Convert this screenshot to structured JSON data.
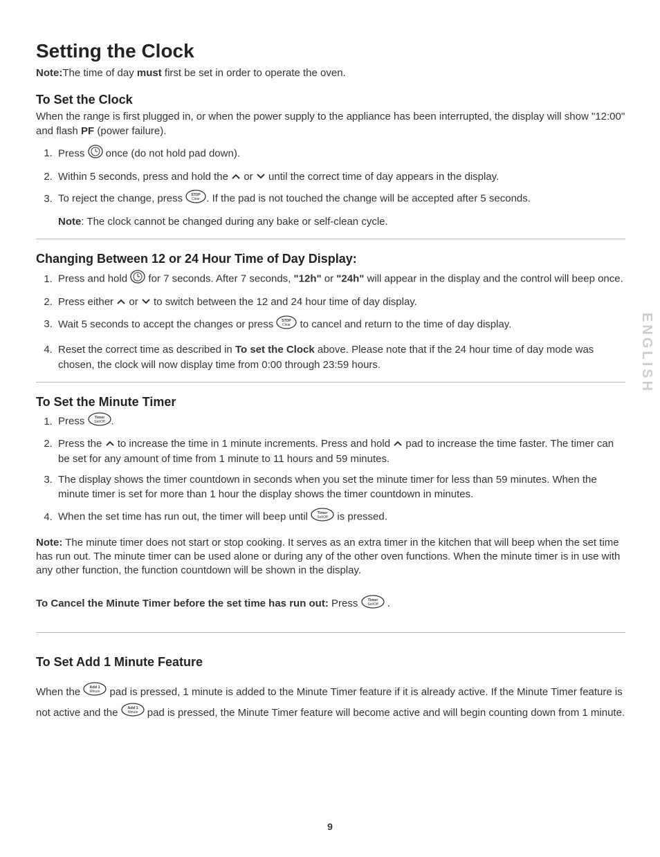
{
  "title": "Setting the Clock",
  "noteLabel": "Note:",
  "intro1": "The time of day ",
  "introMust": "must",
  "intro2": " first be set in order to operate the oven.",
  "setClock": {
    "heading": "To Set the Clock",
    "intro1": "When the range is first plugged in, or when the power supply to the appliance has been interrupted, the display will show \"12:00\" and flash ",
    "pf": "PF",
    "intro2": " (power failure).",
    "s1a": "Press ",
    "s1b": " once (do not hold pad down).",
    "s2a": "Within 5 seconds, press and hold the ",
    "s2b": " or ",
    "s2c": " until the correct time of day appears in the display.",
    "s3a": "To reject the change, press ",
    "s3b": ". If the pad is not touched the change will be accepted after 5 seconds.",
    "noteLabel": "Note",
    "noteText": ": The clock cannot be changed during any bake or self-clean cycle."
  },
  "hour": {
    "heading": "Changing Between 12 or 24 Hour Time of Day Display:",
    "s1a": "Press and hold ",
    "s1b": " for 7 seconds. After 7 seconds, ",
    "s1c": "\"12h\"",
    "s1d": " or ",
    "s1e": "\"24h\"",
    "s1f": " will appear in the display and the control will beep once.",
    "s2a": "Press either ",
    "s2b": " or ",
    "s2c": " to switch between the 12 and 24 hour time of day display.",
    "s3a": "Wait 5 seconds to accept the changes or press ",
    "s3b": " to cancel and return to the time of day display.",
    "s4a": "Reset the correct time as described in ",
    "s4b": "To set the Clock",
    "s4c": " above. Please note that if the 24 hour time of day mode was chosen, the clock will now display time from 0:00 through 23:59 hours."
  },
  "minute": {
    "heading": "To Set the Minute Timer",
    "s1a": "Press ",
    "s1b": ".",
    "s2a": "Press the ",
    "s2b": " to increase the time in 1 minute increments. Press and hold ",
    "s2c": " pad to increase the time faster. The timer can be set for any amount of time from 1 minute to 11 hours and 59 minutes.",
    "s3": "The display shows the timer countdown in seconds when you set the minute timer for less than 59 minutes. When the minute timer is set for more than 1 hour the display shows the timer countdown in minutes.",
    "s4a": "When the set time has run out, the timer will beep until ",
    "s4b": " is pressed.",
    "noteLabel": "Note:",
    "noteText": " The minute timer does not start or stop cooking. It serves as an extra timer in the kitchen that will beep when the set time has run out. The minute timer can be used alone or during any of the other oven functions. When the minute timer is in use with any other function, the function countdown will be shown in the display.",
    "cancel1": "To Cancel the Minute Timer before the set time has run out:",
    "cancel2": " Press ",
    "cancel3": " ."
  },
  "add1": {
    "heading": "To Set Add 1 Minute Feature",
    "p1a": "When the ",
    "p1b": " pad is pressed, 1 minute is added to the Minute Timer feature if it is already active. If the Minute Timer feature is not active and the ",
    "p1c": " pad is pressed, the Minute Timer feature will become active and will begin counting down from 1 minute."
  },
  "sideTab": "ENGLISH",
  "pageNumber": "9",
  "iconLabels": {
    "clock": "clock",
    "up": "up-arrow",
    "down": "down-arrow",
    "stop": "STOP Clear",
    "timer": "Timer Set/Off",
    "add1": "Add 1 Minute"
  }
}
